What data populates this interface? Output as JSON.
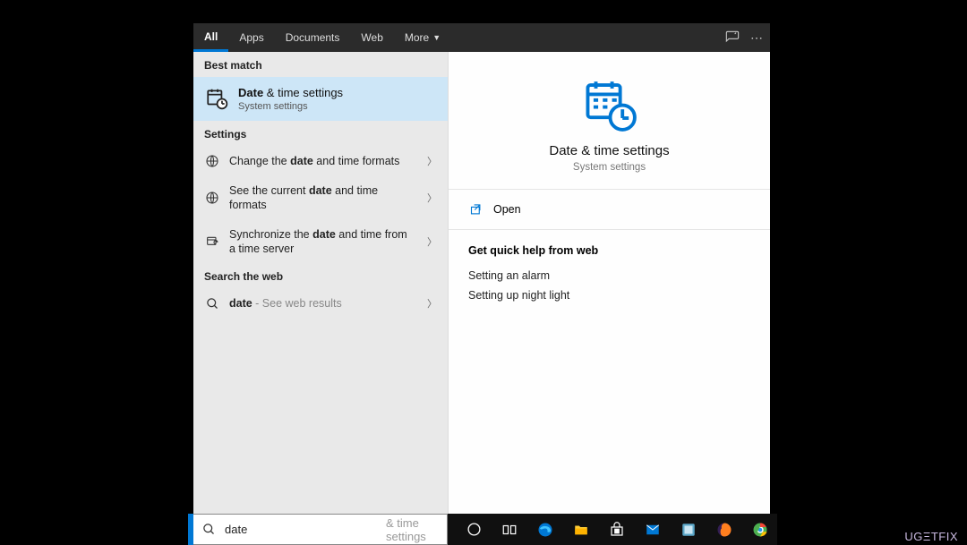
{
  "tabs": {
    "all": "All",
    "apps": "Apps",
    "documents": "Documents",
    "web": "Web",
    "more": "More"
  },
  "left": {
    "best_match_h": "Best match",
    "best": {
      "title_bold": "Date",
      "title_rest": " & time settings",
      "sub": "System settings"
    },
    "settings_h": "Settings",
    "s1_pre": "Change the ",
    "s1_bold": "date",
    "s1_post": " and time formats",
    "s2_pre": "See the current ",
    "s2_bold": "date",
    "s2_post": " and time formats",
    "s3_pre": "Synchronize the ",
    "s3_bold": "date",
    "s3_post": " and time from a time server",
    "web_h": "Search the web",
    "web_bold": "date",
    "web_rest": " - See web results"
  },
  "right": {
    "title": "Date & time settings",
    "sub": "System settings",
    "open": "Open",
    "help_h": "Get quick help from web",
    "help1": "Setting an alarm",
    "help2": "Setting up night light"
  },
  "search": {
    "value": "date",
    "placeholder": " & time settings"
  },
  "watermark": "UGΞTFIX"
}
